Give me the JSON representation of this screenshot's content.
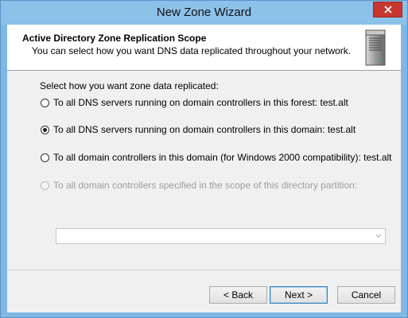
{
  "window": {
    "title": "New Zone Wizard"
  },
  "header": {
    "title": "Active Directory Zone Replication Scope",
    "subtitle": "You can select how you want DNS data replicated throughout your network."
  },
  "content": {
    "prompt": "Select how you want zone data replicated:",
    "options": [
      {
        "label": "To all DNS servers running on domain controllers in this forest: test.alt",
        "checked": false,
        "enabled": true
      },
      {
        "label": "To all DNS servers running on domain controllers in this domain: test.alt",
        "checked": true,
        "enabled": true
      },
      {
        "label": "To all domain controllers in this domain (for Windows 2000 compatibility): test.alt",
        "checked": false,
        "enabled": true
      },
      {
        "label": "To all domain controllers specified in the scope of this directory partition:",
        "checked": false,
        "enabled": false
      }
    ],
    "partition_select": {
      "value": "",
      "enabled": false
    }
  },
  "buttons": {
    "back": "< Back",
    "next": "Next >",
    "cancel": "Cancel"
  },
  "icons": {
    "close": "close-icon",
    "server": "server-icon",
    "dropdown": "chevron-down-icon"
  }
}
